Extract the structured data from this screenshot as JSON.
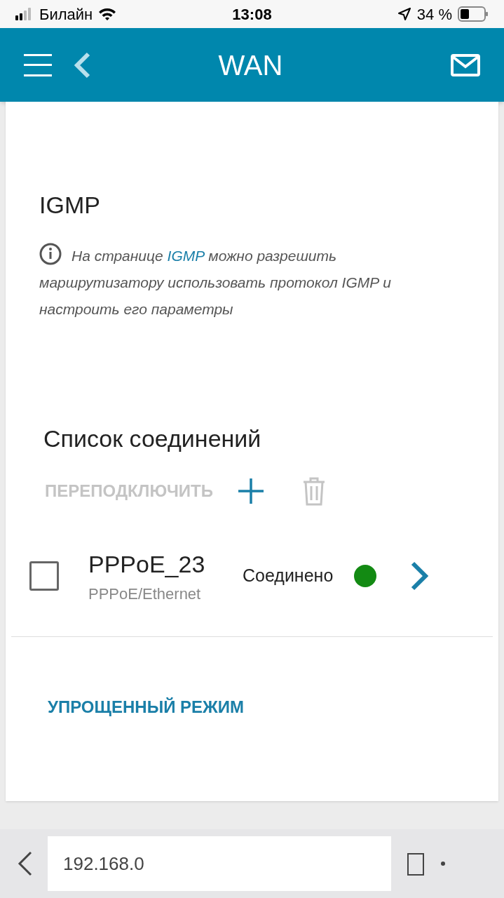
{
  "status_bar": {
    "carrier": "Билайн",
    "time": "13:08",
    "battery": "34 %"
  },
  "header": {
    "title": "WAN"
  },
  "section": {
    "title": "IGMP",
    "info": {
      "before": "На странице ",
      "link": "IGMP",
      "after": " можно разрешить маршрутизатору использовать протокол IGMP и настроить его параметры"
    }
  },
  "connections": {
    "title": "Список соединений",
    "reconnect": {
      "label": "ПЕРЕПОДКЛЮЧИТЬ",
      "disabled": true
    },
    "add": {
      "disabled": false
    },
    "delete": {
      "disabled": true
    },
    "rows": [
      {
        "name": "PPPoE_23",
        "type": "PPPoE/Ethernet",
        "status": "Соединено",
        "color": "#138a13",
        "checked": false
      }
    ]
  },
  "mode_link": "УПРОЩЕННЫЙ РЕЖИМ",
  "browser_bar": {
    "url": "192.168.0"
  }
}
